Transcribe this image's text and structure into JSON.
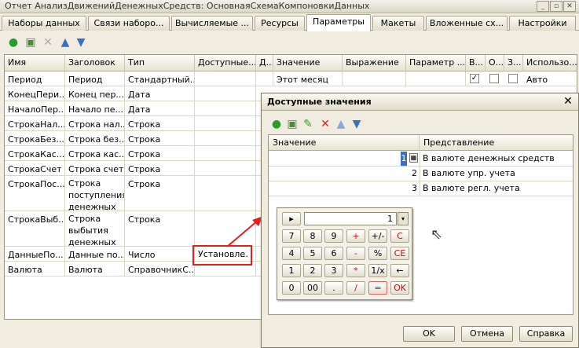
{
  "window": {
    "title": "Отчет АнализДвиженийДенежныхСредств: ОсновнаяСхемаКомпоновкиДанных",
    "min": "_",
    "restore": "▫",
    "close": "✕"
  },
  "tabs": [
    "Наборы данных",
    "Связи наборо...",
    "Вычисляемые ...",
    "Ресурсы",
    "Параметры",
    "Макеты",
    "Вложенные сх...",
    "Настройки"
  ],
  "toolbar_icons": [
    "add-icon",
    "copy-icon",
    "delete-icon",
    "up-icon",
    "down-icon"
  ],
  "grid": {
    "headers": [
      "Имя",
      "Заголовок",
      "Тип",
      "Доступные...",
      "Д...",
      "Значение",
      "Выражение",
      "Параметр ...",
      "В...",
      "О...",
      "З...",
      "Использо..."
    ],
    "rows": [
      {
        "name": "Период",
        "title": "Период",
        "type": "Стандартный...",
        "value": "Этот месяц",
        "use": "Авто",
        "check_b": "✓"
      },
      {
        "name": "КонецПери...",
        "title": "Конец пер...",
        "type": "Дата"
      },
      {
        "name": "НачалоПер...",
        "title": "Начало пе...",
        "type": "Дата"
      },
      {
        "name": "СтрокаНал...",
        "title": "Строка нал...",
        "type": "Строка"
      },
      {
        "name": "СтрокаБез...",
        "title": "Строка без...",
        "type": "Строка"
      },
      {
        "name": "СтрокаКас...",
        "title": "Строка кас...",
        "type": "Строка"
      },
      {
        "name": "СтрокаСчет",
        "title": "Строка счет",
        "type": "Строка"
      },
      {
        "name": "СтрокаПос...",
        "title": "Строка поступления денежных ...",
        "type": "Строка"
      },
      {
        "name": "СтрокаВыб...",
        "title": "Строка выбытия денежных ...",
        "type": "Строка"
      },
      {
        "name": "ДанныеПо...",
        "title": "Данные по...",
        "type": "Число"
      },
      {
        "name": "Валюта",
        "title": "Валюта",
        "type": "СправочникС..."
      }
    ],
    "available_value": "Установле",
    "ellipsis": "..."
  },
  "dialog": {
    "title": "Доступные значения",
    "close": "✕",
    "columns": [
      "Значение",
      "Представление"
    ],
    "rows": [
      {
        "num": "1",
        "text": "В валюте денежных средств"
      },
      {
        "num": "2",
        "text": "В валюте упр. учета"
      },
      {
        "num": "3",
        "text": "В валюте регл. учета"
      }
    ],
    "buttons": {
      "ok": "OK",
      "cancel": "Отмена",
      "help": "Справка"
    }
  },
  "calculator": {
    "display": "1",
    "toggle": "▸",
    "drop": "▾",
    "rows": [
      [
        "7",
        "8",
        "9",
        "+",
        "+/-",
        "C"
      ],
      [
        "4",
        "5",
        "6",
        "-",
        "%",
        "CE"
      ],
      [
        "1",
        "2",
        "3",
        "*",
        "1/x",
        "←"
      ],
      [
        "0",
        "00",
        ".",
        "/",
        "=",
        "OK"
      ]
    ]
  },
  "colors": {
    "highlight": "#e02020",
    "arrow": "#e02020"
  }
}
